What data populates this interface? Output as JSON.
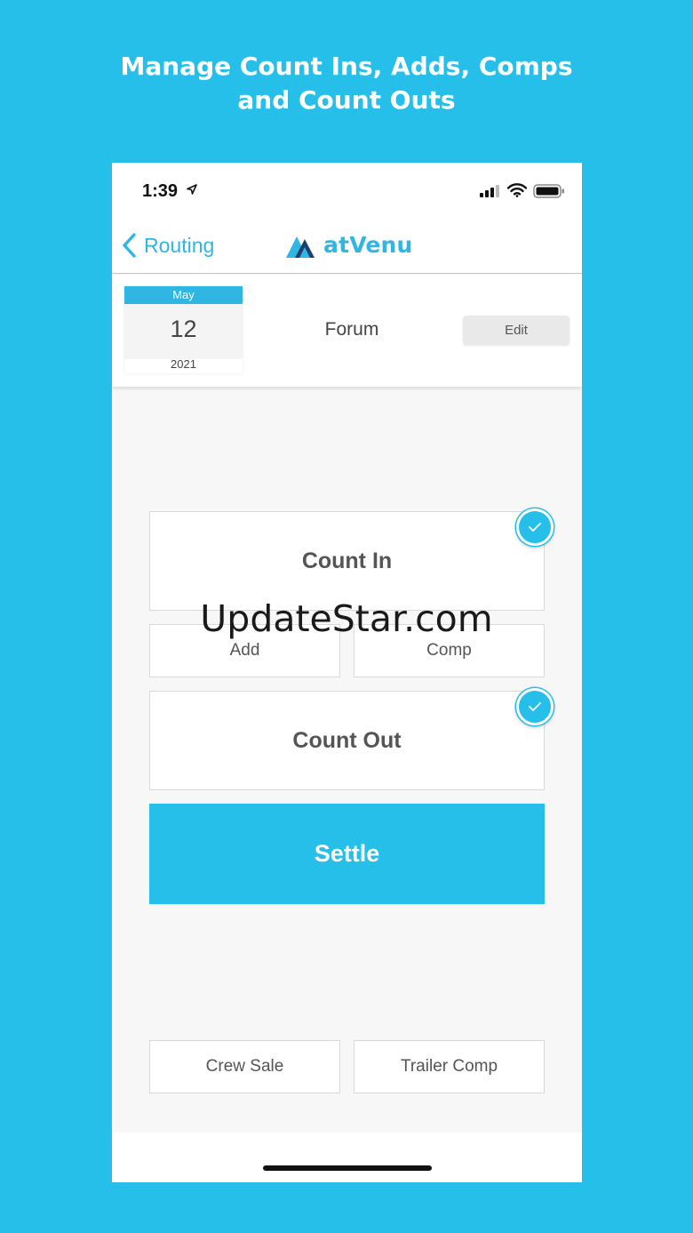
{
  "promo": {
    "line1": "Manage Count Ins, Adds, Comps",
    "line2": "and Count Outs"
  },
  "status_bar": {
    "time": "1:39",
    "icons": [
      "location-arrow-icon",
      "signal-icon",
      "wifi-icon",
      "battery-icon"
    ]
  },
  "nav": {
    "back_label": "Routing",
    "app_name": "atVenu"
  },
  "event": {
    "month": "May",
    "day": "12",
    "year": "2021",
    "venue": "Forum",
    "edit_label": "Edit"
  },
  "actions": {
    "count_in": "Count In",
    "count_in_completed": true,
    "add": "Add",
    "comp": "Comp",
    "count_out": "Count Out",
    "count_out_completed": true,
    "settle": "Settle",
    "crew_sale": "Crew Sale",
    "trailer_comp": "Trailer Comp"
  },
  "colors": {
    "brand": "#26bfe9",
    "accent_text": "#2fb6e3",
    "logo_dark": "#1d3f6e"
  },
  "watermark": "UpdateStar.com"
}
